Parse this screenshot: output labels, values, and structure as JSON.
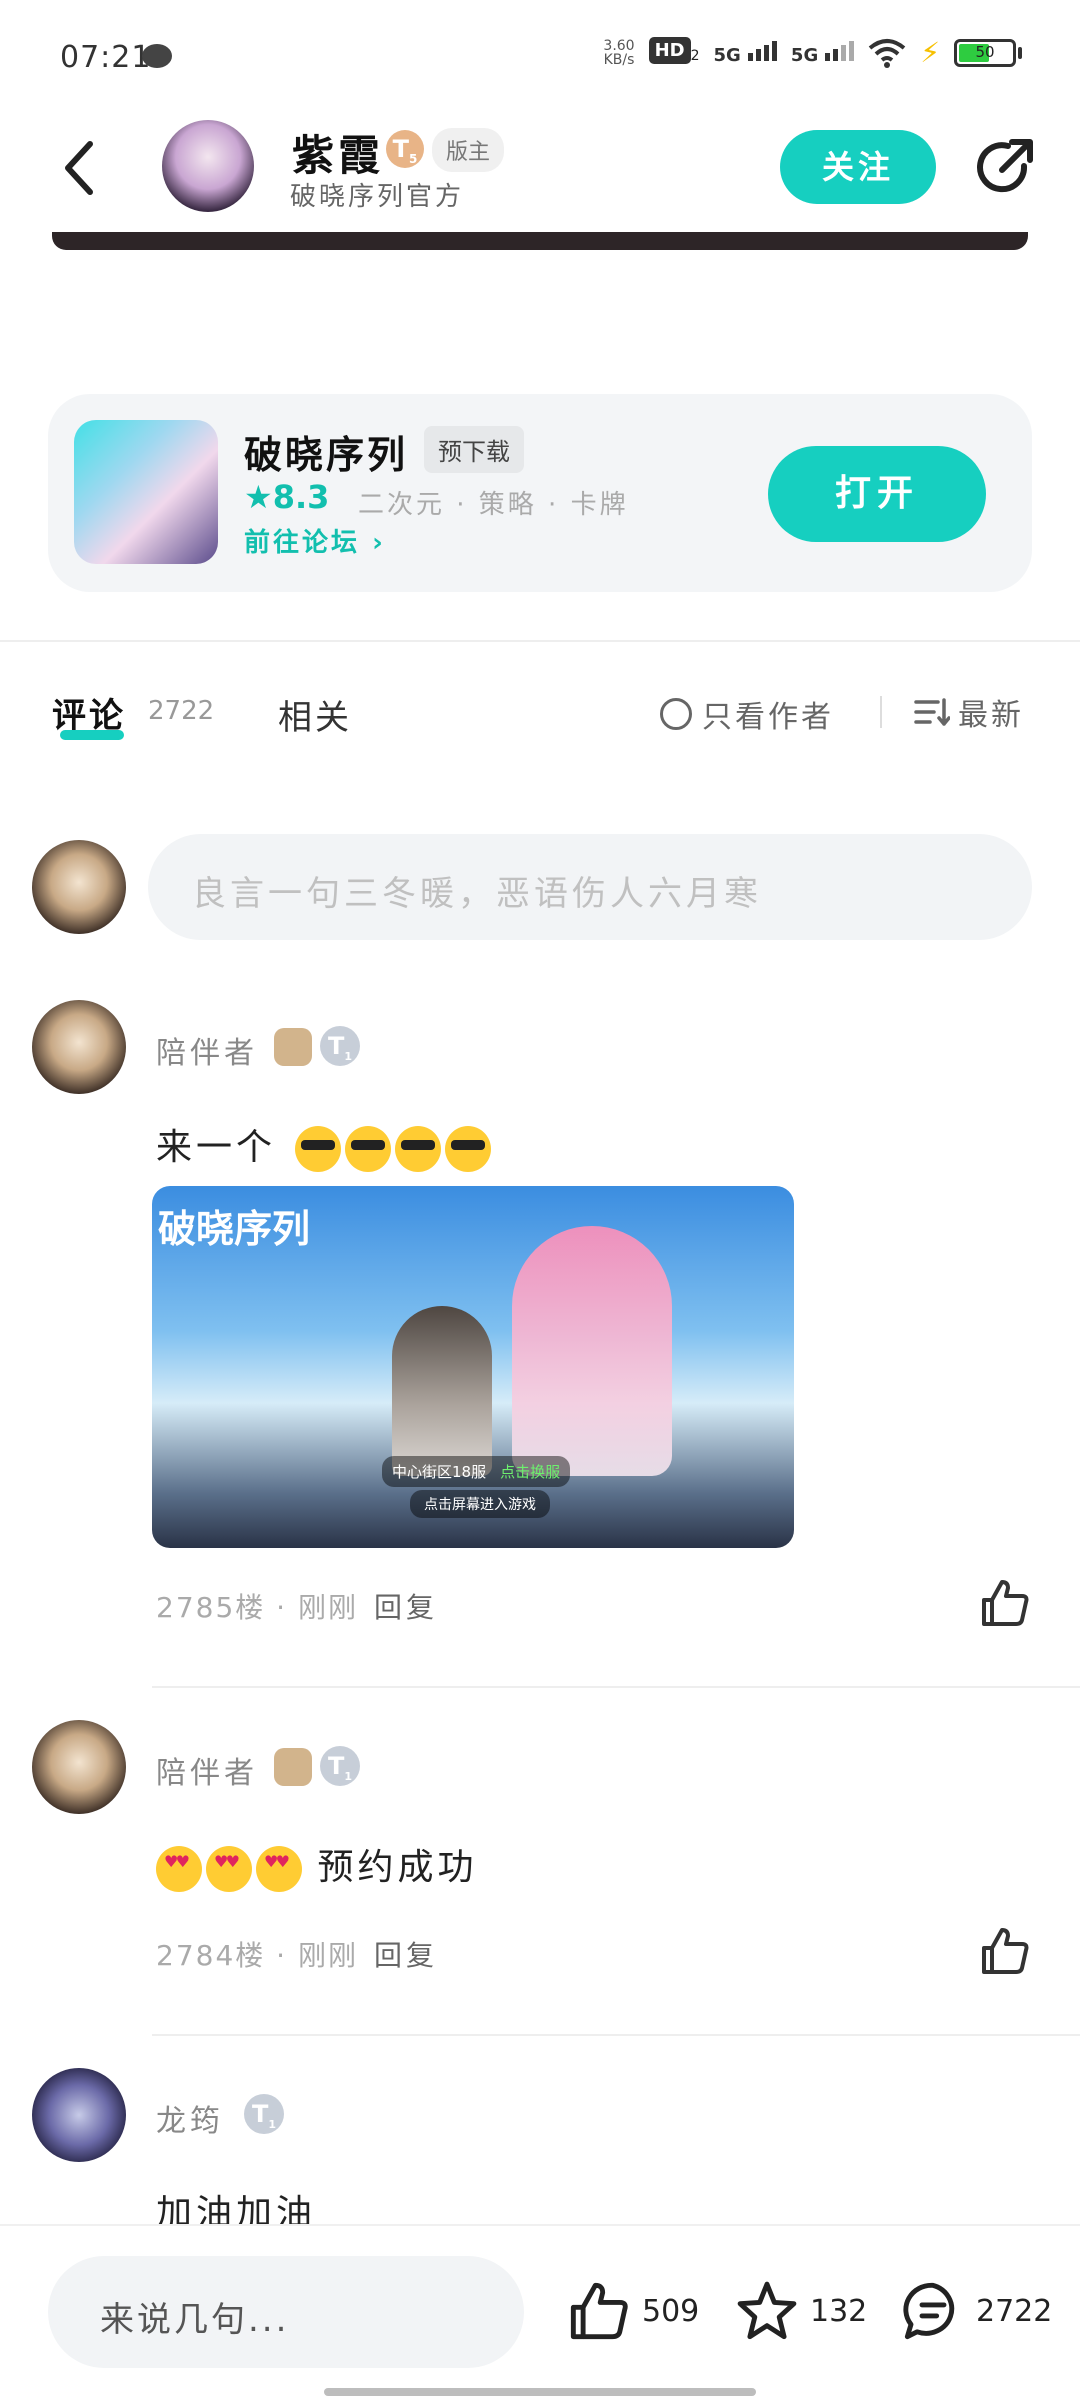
{
  "status_bar": {
    "time": "07:21",
    "net_speed_value": "3.60",
    "net_speed_unit": "KB/s",
    "hd_label": "HD",
    "hd_sub": "2",
    "signal1": "5G",
    "signal2": "5G",
    "battery": "50"
  },
  "header": {
    "author_name": "紫霞",
    "level": "T",
    "level_sub": "5",
    "role": "版主",
    "subtitle": "破晓序列官方",
    "follow_label": "关注"
  },
  "game_card": {
    "title": "破晓序列",
    "badge": "预下载",
    "rating": "8.3",
    "tags": "二次元 · 策略 · 卡牌",
    "forum_link": "前往论坛",
    "open_label": "打开"
  },
  "tabs": {
    "comments_label": "评论",
    "comments_count": "2722",
    "related_label": "相关",
    "author_only_label": "只看作者",
    "sort_label": "最新"
  },
  "comment_input": {
    "placeholder": "良言一句三冬暖，恶语伤人六月寒"
  },
  "comments": [
    {
      "name": "陪伴者",
      "badge_level": "T",
      "badge_level_sub": "1",
      "text": "来一个",
      "emoji_count": 4,
      "floor": "2785楼 · 刚刚",
      "reply_label": "回复",
      "image": {
        "logo": "破晓序列",
        "server": "中心街区18服",
        "switch_label": "点击换服",
        "enter_label": "点击屏幕进入游戏"
      }
    },
    {
      "name": "陪伴者",
      "badge_level": "T",
      "badge_level_sub": "1",
      "text": "预约成功",
      "emoji_count": 3,
      "floor": "2784楼 · 刚刚",
      "reply_label": "回复"
    },
    {
      "name": "龙筠",
      "badge_level": "T",
      "badge_level_sub": "1",
      "text": "加油加油"
    }
  ],
  "bottom_bar": {
    "input_placeholder": "来说几句...",
    "likes": "509",
    "favorites": "132",
    "comments": "2722"
  },
  "colors": {
    "accent": "#16cfc0",
    "accent_text": "#12bfae"
  }
}
